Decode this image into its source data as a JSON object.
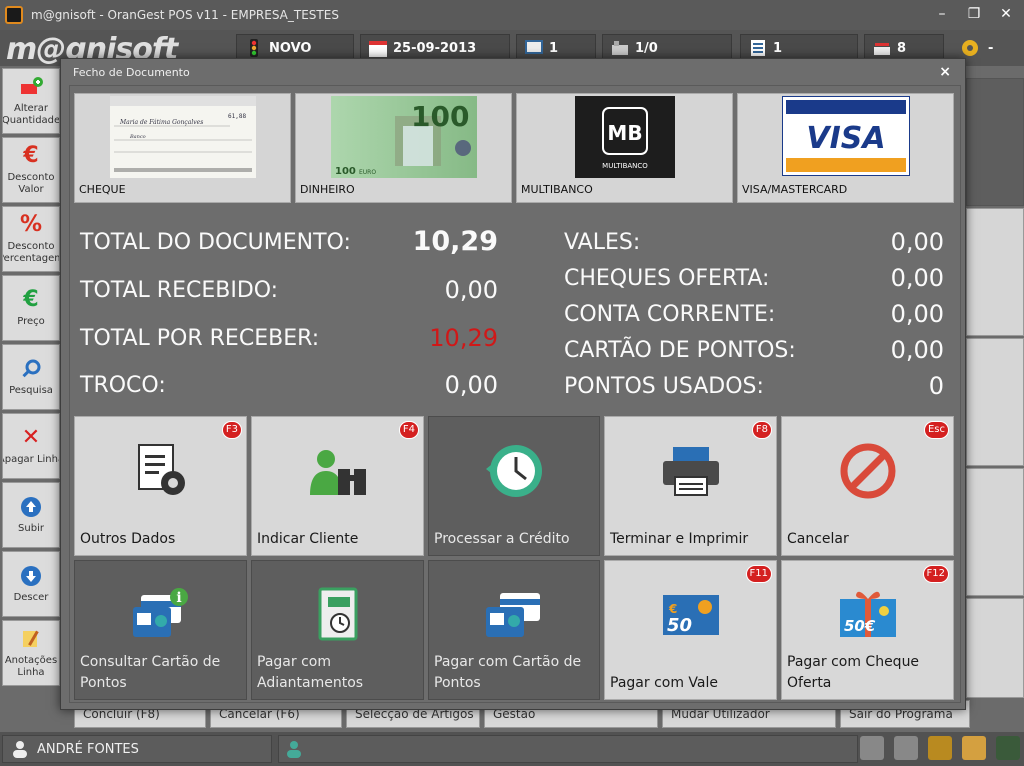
{
  "window": {
    "title": "m@gnisoft - OranGest POS v11 - EMPRESA_TESTES"
  },
  "topbar": {
    "logo": "m@gnisoft",
    "doc_type": "NOVO",
    "date": "25-09-2013",
    "date_day": "23",
    "terminal": "1",
    "table": "1/0",
    "list_count": "1",
    "items_count": "8",
    "settings_suffix": "-"
  },
  "leftbar": [
    {
      "label": "Alterar\nQuantidade",
      "icon": "cart-plus-icon"
    },
    {
      "label": "Desconto\nValor",
      "icon": "euro-icon"
    },
    {
      "label": "Desconto\nPercentagem",
      "icon": "percent-icon"
    },
    {
      "label": "Preço",
      "icon": "euro-icon"
    },
    {
      "label": "Pesquisa",
      "icon": "search-icon"
    },
    {
      "label": "Apagar Linha",
      "icon": "close-icon"
    },
    {
      "label": "Subir",
      "icon": "arrow-up-icon"
    },
    {
      "label": "Descer",
      "icon": "arrow-down-icon"
    },
    {
      "label": "Anotações\nLinha",
      "icon": "note-icon"
    }
  ],
  "bottom_buttons": [
    "Concluir (F8)",
    "Cancelar (F6)",
    "Selecção de Artigos",
    "Gestão",
    "Mudar Utilizador",
    "Sair do Programa"
  ],
  "statusbar": {
    "user": "ANDRÉ FONTES"
  },
  "modal": {
    "title": "Fecho de Documento",
    "close": "×",
    "payments": [
      {
        "label": "CHEQUE"
      },
      {
        "label": "DINHEIRO",
        "note_value": "100",
        "note_currency": "EURO"
      },
      {
        "label": "MULTIBANCO",
        "logo": "MB",
        "logo_sub": "MULTIBANCO"
      },
      {
        "label": "VISA/MASTERCARD",
        "logo": "VISA"
      }
    ],
    "cheque_text": {
      "name": "Maria de Fátima Gonçalves",
      "bank": "Banco",
      "amount": "61,88"
    },
    "totals_left": [
      {
        "label": "TOTAL DO DOCUMENTO:",
        "value": "10,29"
      },
      {
        "label": "TOTAL RECEBIDO:",
        "value": "0,00"
      },
      {
        "label": "TOTAL POR RECEBER:",
        "value": "10,29"
      },
      {
        "label": "TROCO:",
        "value": "0,00"
      }
    ],
    "totals_right": [
      {
        "label": "VALES:",
        "value": "0,00"
      },
      {
        "label": "CHEQUES OFERTA:",
        "value": "0,00"
      },
      {
        "label": "CONTA CORRENTE:",
        "value": "0,00"
      },
      {
        "label": "CARTÃO DE PONTOS:",
        "value": "0,00"
      },
      {
        "label": "PONTOS USADOS:",
        "value": "0"
      }
    ],
    "actions": [
      {
        "label": "Outros Dados",
        "badge": "F3",
        "icon": "document-gear-icon"
      },
      {
        "label": "Indicar Cliente",
        "badge": "F4",
        "icon": "client-binoculars-icon"
      },
      {
        "label": "Processar a Crédito",
        "badge": "",
        "icon": "clock-history-icon"
      },
      {
        "label": "Terminar e Imprimir",
        "badge": "F8",
        "icon": "printer-icon"
      },
      {
        "label": "Cancelar",
        "badge": "Esc",
        "icon": "cancel-icon"
      },
      {
        "label": "Consultar Cartão de Pontos",
        "badge": "",
        "icon": "card-info-icon"
      },
      {
        "label": "Pagar com Adiantamentos",
        "badge": "",
        "icon": "notebook-clock-icon"
      },
      {
        "label": "Pagar com Cartão de Pontos",
        "badge": "",
        "icon": "card-pay-icon"
      },
      {
        "label": "Pagar com Vale",
        "badge": "F11",
        "icon": "voucher-icon"
      },
      {
        "label": "Pagar com Cheque Oferta",
        "badge": "F12",
        "icon": "gift-cheque-icon"
      }
    ],
    "voucher_value": "50",
    "gift_value": "50€"
  },
  "colors": {
    "accent_red": "#d42020",
    "pending_red": "#d01818",
    "modal_bg": "#6d6d6d"
  }
}
